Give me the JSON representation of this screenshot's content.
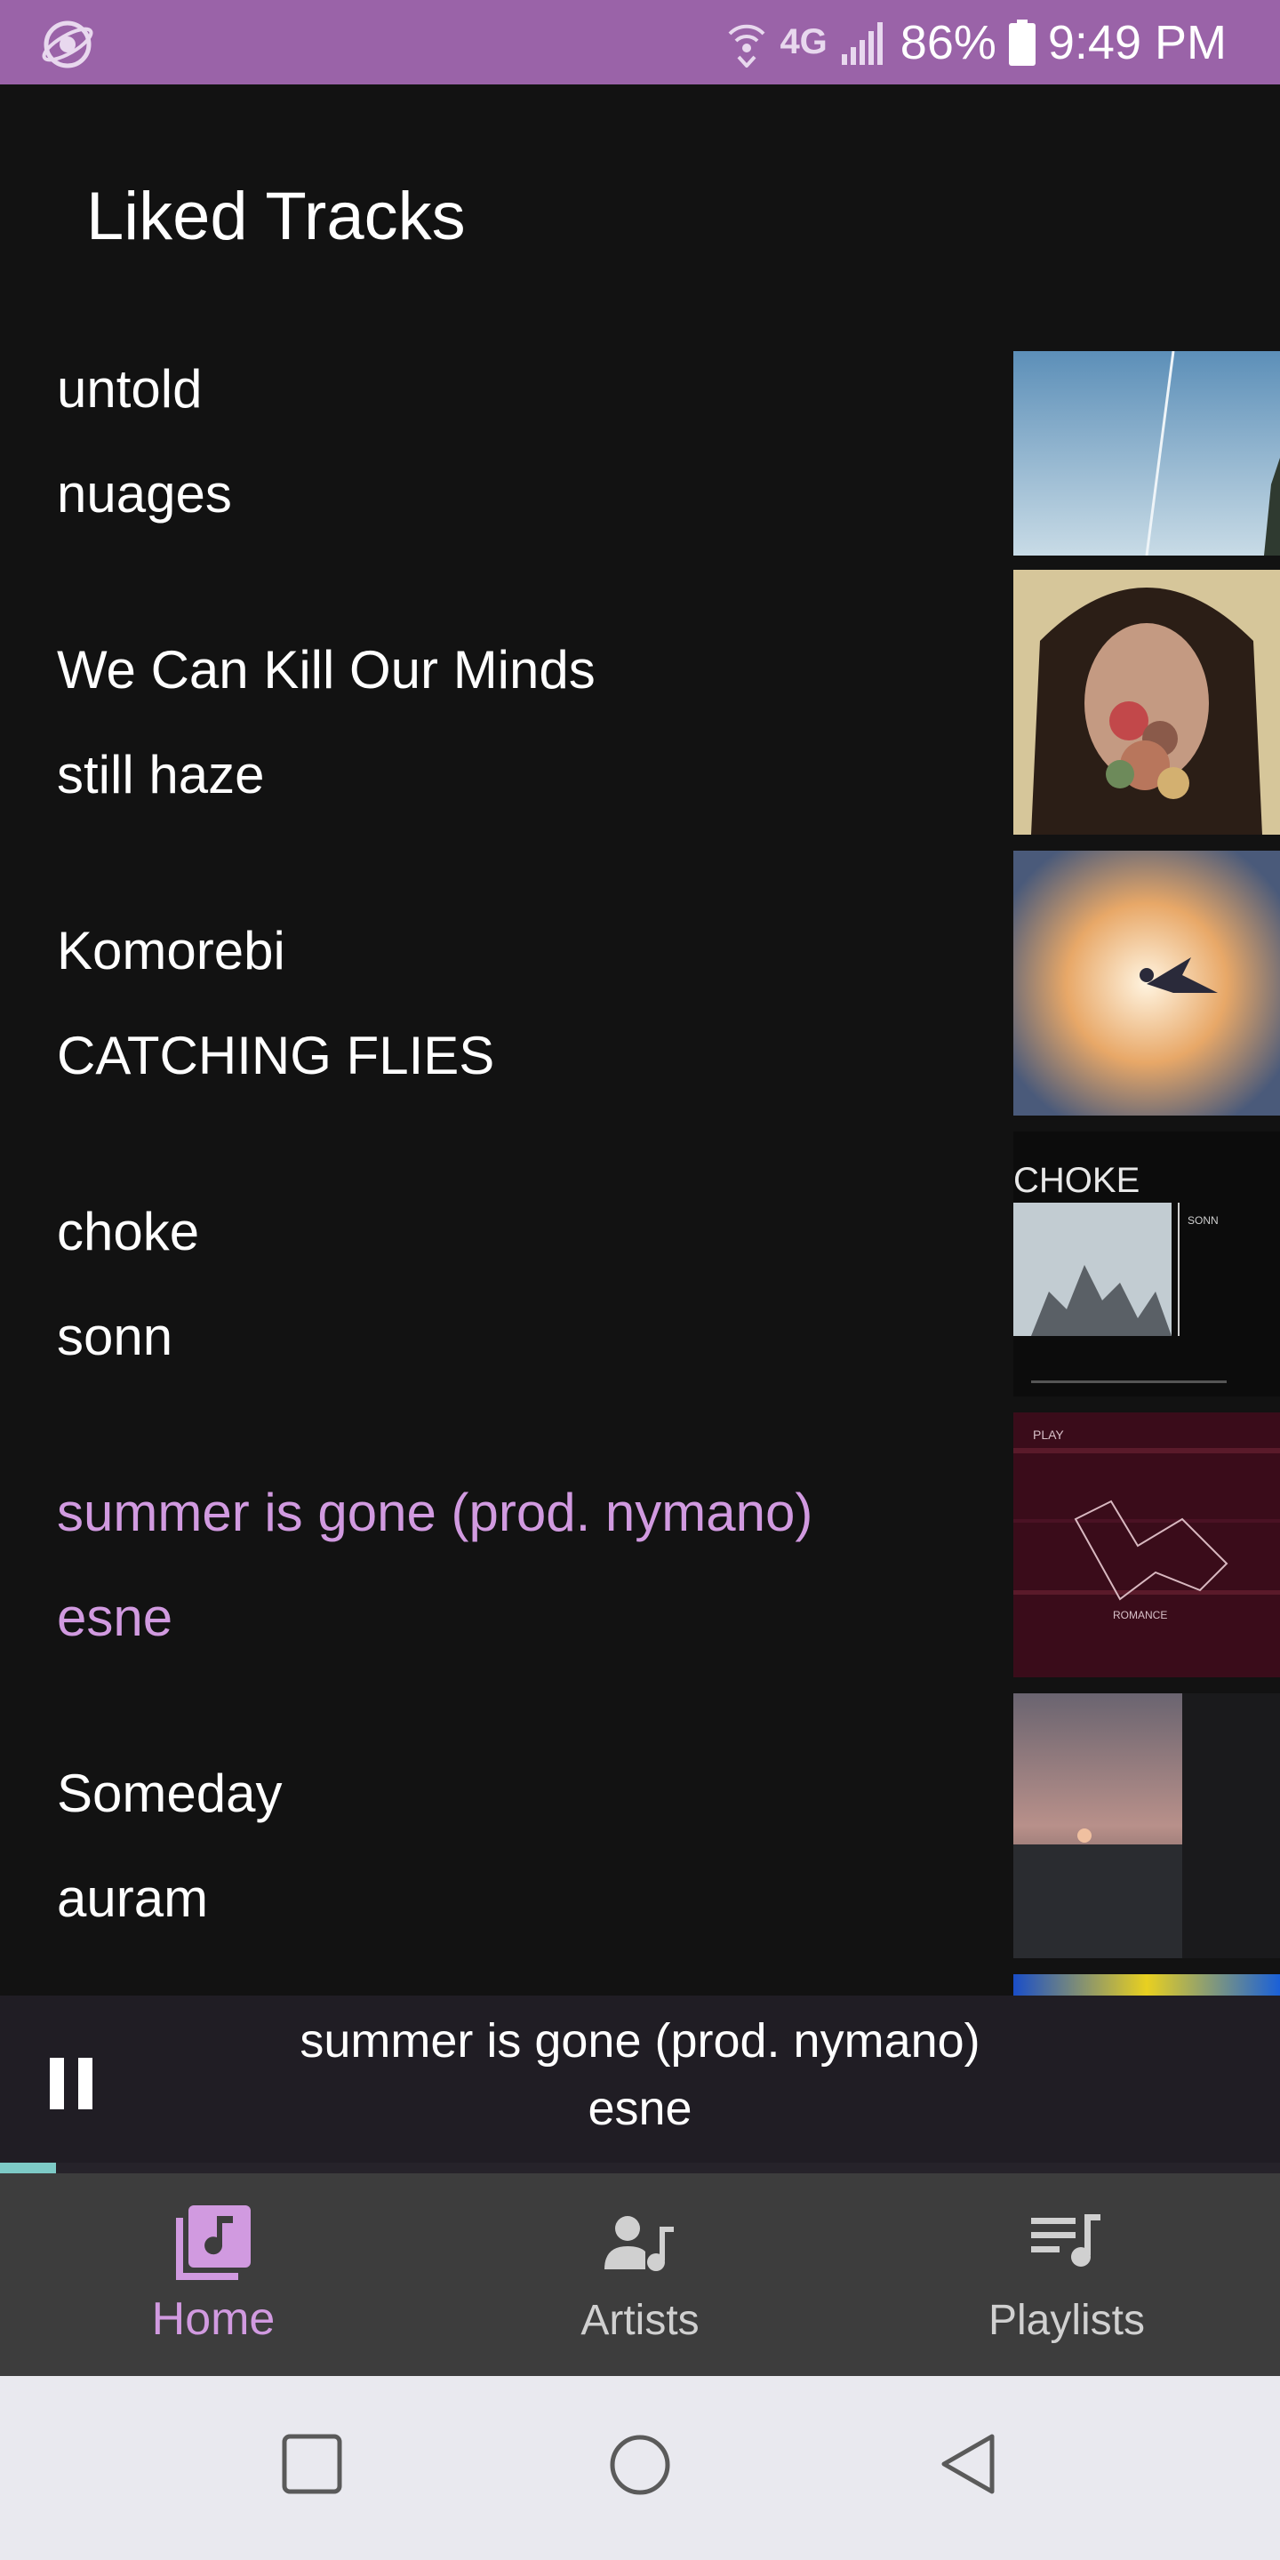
{
  "status_bar": {
    "network": "4G",
    "battery": "86%",
    "time": "9:49 PM",
    "icons": [
      "app-logo-icon",
      "wifi-calling-icon",
      "signal-icon",
      "battery-icon"
    ]
  },
  "header": {
    "title": "Liked Tracks"
  },
  "tracks": [
    {
      "title": "untold",
      "artist": "nuages",
      "active": false
    },
    {
      "title": "We Can Kill Our Minds",
      "artist": "still haze",
      "active": false
    },
    {
      "title": "Komorebi",
      "artist": "CATCHING FLIES",
      "active": false
    },
    {
      "title": "choke",
      "artist": "sonn",
      "active": false,
      "art_text": "CHOKE",
      "art_subtext": "SONN"
    },
    {
      "title": "summer is gone (prod. nymano)",
      "artist": "esne",
      "active": true,
      "art_text": "PLAY",
      "art_subtext": "ROMANCE"
    },
    {
      "title": "Someday",
      "artist": "auram",
      "active": false
    }
  ],
  "now_playing": {
    "title": "summer is gone (prod. nymano)",
    "artist": "esne",
    "state_icon": "pause-icon",
    "progress_fraction": 0.044
  },
  "bottom_nav": {
    "items": [
      {
        "label": "Home",
        "icon": "music-library-icon",
        "active": true
      },
      {
        "label": "Artists",
        "icon": "artist-icon",
        "active": false
      },
      {
        "label": "Playlists",
        "icon": "playlist-icon",
        "active": false
      }
    ]
  },
  "system_nav": {
    "icons": [
      "recent-apps-icon",
      "home-icon",
      "back-icon"
    ]
  },
  "colors": {
    "status_bar": "#9a63a8",
    "background": "#121212",
    "accent": "#d19ae0",
    "progress": "#7dcac6",
    "now_playing_bg": "#201d24",
    "bottom_nav_bg": "#3d3d3d"
  }
}
